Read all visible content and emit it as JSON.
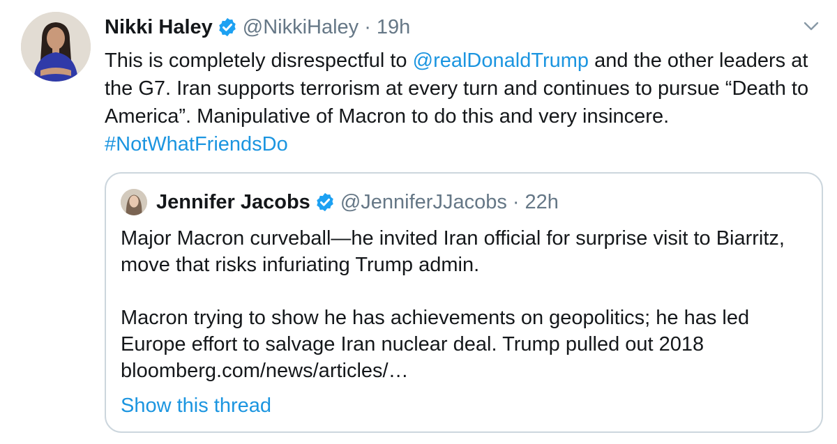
{
  "tweet": {
    "author_name": "Nikki Haley",
    "author_handle": "@NikkiHaley",
    "separator": "·",
    "time": "19h",
    "verified_icon": "verified-badge-icon",
    "menu_icon": "chevron-down-icon",
    "body": {
      "text_1": "This is completely disrespectful to ",
      "mention": "@realDonaldTrump",
      "text_2": " and the other leaders at the G7. Iran supports terrorism at every turn and continues to pursue “Death to America”. Manipulative of Macron to do this and very insincere. ",
      "hashtag": "#NotWhatFriendsDo"
    }
  },
  "quoted_tweet": {
    "author_name": "Jennifer Jacobs",
    "author_handle": "@JenniferJJacobs",
    "separator": "·",
    "time": "22h",
    "paragraph_1": "Major Macron curveball—he invited Iran official for surprise visit to Biarritz, move that risks infuriating Trump admin.",
    "paragraph_2": "Macron trying to show he has achievements on geopolitics; he has led Europe effort to salvage Iran nuclear deal. Trump pulled out 2018",
    "link": "bloomberg.com/news/articles/…",
    "show_thread_label": "Show this thread"
  },
  "colors": {
    "link": "#1b95e0",
    "muted": "#657786",
    "verified": "#1da1f2",
    "border": "#ccd6dd"
  }
}
